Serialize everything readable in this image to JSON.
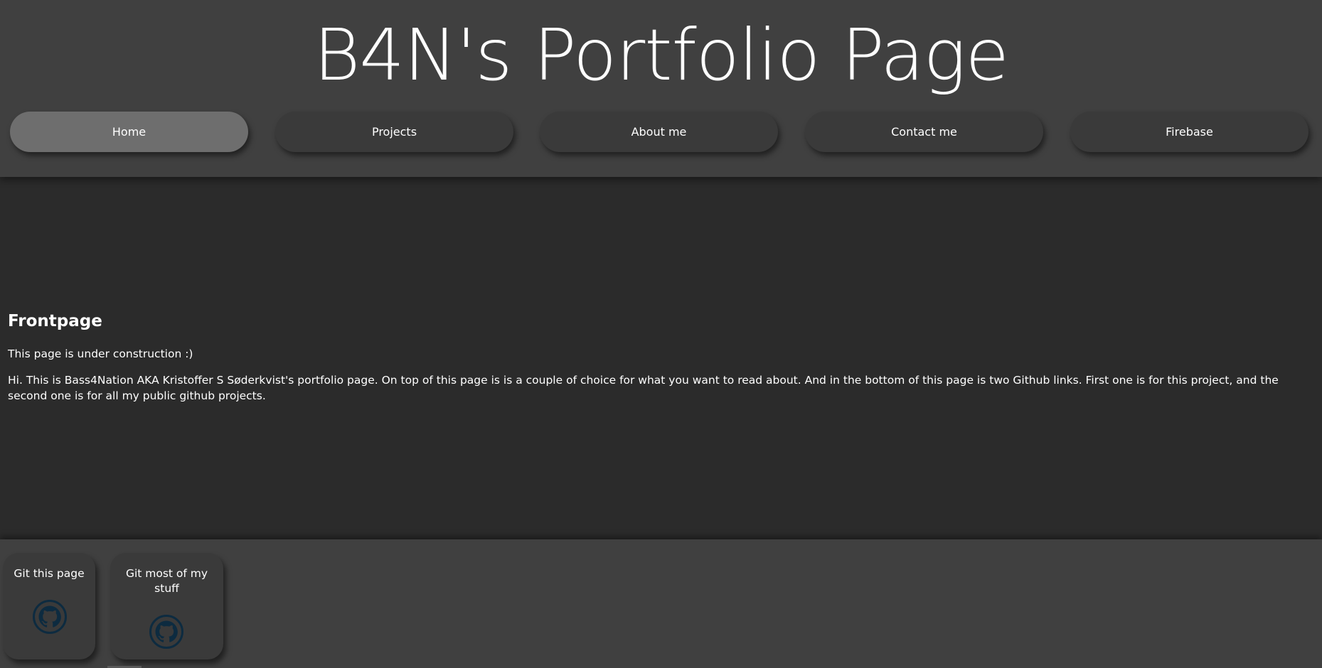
{
  "header": {
    "title": "B4N's Portfolio Page"
  },
  "nav": {
    "items": [
      {
        "label": "Home",
        "active": true
      },
      {
        "label": "Projects",
        "active": false
      },
      {
        "label": "About me",
        "active": false
      },
      {
        "label": "Contact me",
        "active": false
      },
      {
        "label": "Firebase",
        "active": false
      }
    ]
  },
  "main": {
    "heading": "Frontpage",
    "construction_text": "This page is under construction :)",
    "intro_text": "Hi. This is Bass4Nation AKA Kristoffer S Søderkvist's portfolio page. On top of this page is is a couple of choice for what you want to read about. And in the bottom of this page is two Github links. First one is for this project, and the second one is for all my public github projects."
  },
  "footer": {
    "links": [
      {
        "label": "Git this page",
        "icon": "github-icon"
      },
      {
        "label": "Git most of my stuff",
        "icon": "github-icon"
      }
    ]
  },
  "colors": {
    "header_bg": "#404040",
    "body_bg": "#2b2b2b",
    "button_bg": "#3a3a3a",
    "button_active_bg": "#6e6e6e",
    "icon_color": "#0d2b40"
  }
}
